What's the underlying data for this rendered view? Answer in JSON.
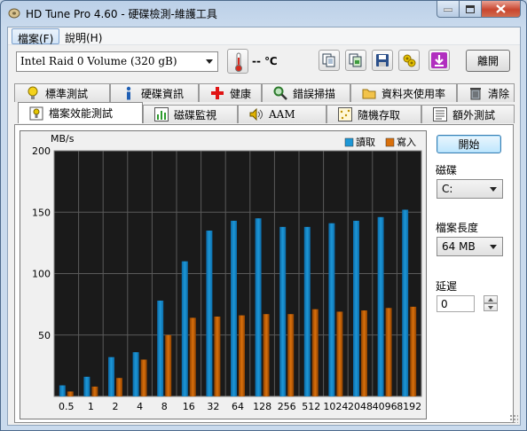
{
  "window": {
    "title": "HD Tune Pro 4.60 - 硬碟檢測-維護工具",
    "accent": "#c9daed",
    "icon": "hdd-icon"
  },
  "menu": [
    {
      "label": "檔案(F)",
      "active": true
    },
    {
      "label": "說明(H)",
      "active": false
    }
  ],
  "toolbar": {
    "drive": "Intel   Raid 0 Volume  (320 gB)",
    "temperature": "-- ℃",
    "icons": [
      "copy-text-icon",
      "copy-screenshot-icon",
      "save-icon",
      "options-icon",
      "download-icon"
    ],
    "exit_label": "離開"
  },
  "tabs_top": [
    {
      "label": "標準測試",
      "icon": "lightbulb-icon"
    },
    {
      "label": "硬碟資訊",
      "icon": "info-icon"
    },
    {
      "label": "健康",
      "icon": "health-cross-icon"
    },
    {
      "label": "錯誤掃描",
      "icon": "magnifier-icon"
    },
    {
      "label": "資料夾使用率",
      "icon": "folder-icon"
    },
    {
      "label": "清除",
      "icon": "trash-icon"
    }
  ],
  "tabs_bottom": [
    {
      "label": "檔案效能測試",
      "icon": "file-benchmark-icon",
      "selected": true
    },
    {
      "label": "磁碟監視",
      "icon": "monitor-chart-icon",
      "selected": false
    },
    {
      "label": "AAM",
      "icon": "speaker-icon",
      "selected": false
    },
    {
      "label": "隨機存取",
      "icon": "random-access-icon",
      "selected": false
    },
    {
      "label": "額外測試",
      "icon": "extra-tests-icon",
      "selected": false
    }
  ],
  "side": {
    "start_label": "開始",
    "drive_label": "磁碟",
    "drive_value": "C:",
    "filesize_label": "檔案長度",
    "filesize_value": "64 MB",
    "delay_label": "延遲",
    "delay_value": "0"
  },
  "chart_data": {
    "type": "bar",
    "title": "",
    "ylabel": "MB/s",
    "xlabel": "",
    "ylim": [
      0,
      200
    ],
    "yticks": [
      50,
      100,
      150,
      200
    ],
    "grid": true,
    "legend": "top-right",
    "categories": [
      "0.5",
      "1",
      "2",
      "4",
      "8",
      "16",
      "32",
      "64",
      "128",
      "256",
      "512",
      "1024",
      "2048",
      "4096",
      "8192"
    ],
    "series": [
      {
        "name": "讀取",
        "color": "#1d97d6",
        "values": [
          9,
          16,
          32,
          36,
          78,
          110,
          135,
          143,
          145,
          138,
          138,
          141,
          143,
          146,
          152
        ]
      },
      {
        "name": "寫入",
        "color": "#d9700c",
        "values": [
          4,
          8,
          15,
          30,
          50,
          64,
          65,
          66,
          67,
          67,
          71,
          69,
          70,
          72,
          73
        ]
      }
    ],
    "background": "#1a1a1a"
  }
}
